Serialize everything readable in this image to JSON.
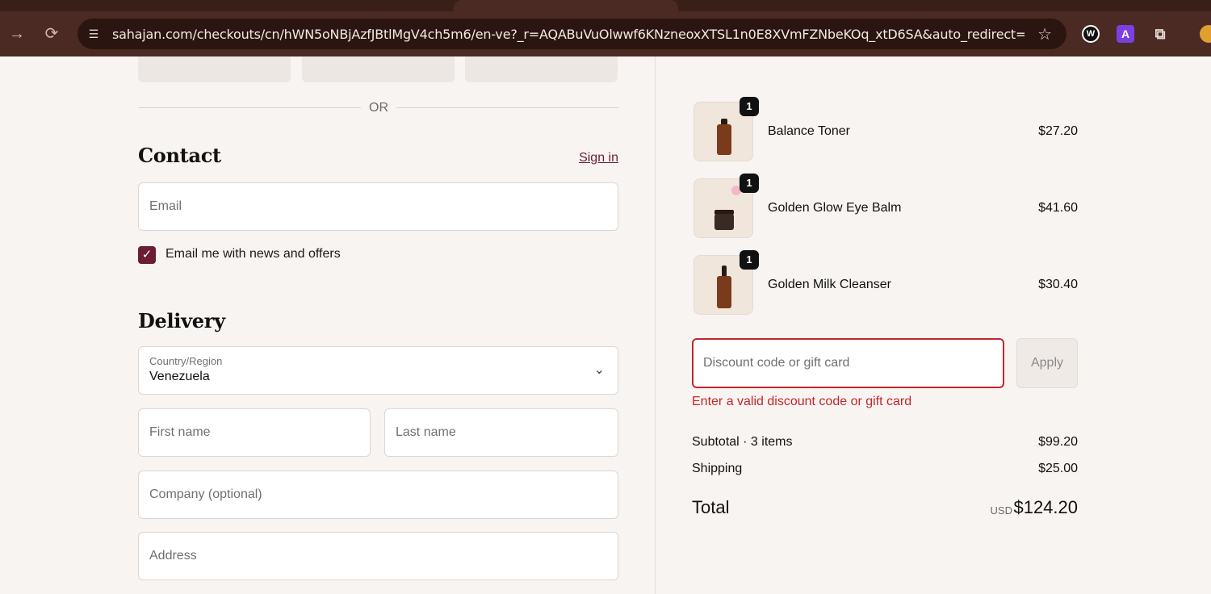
{
  "browser": {
    "url": "sahajan.com/checkouts/cn/hWN5oNBjAzfJBtlMgV4ch5m6/en-ve?_r=AQABuVuOlwwf6KNzneoxXTSL1n0E8XVmFZNbeKOq_xtD6SA&auto_redirect=false&...",
    "ext_a_label": "A"
  },
  "express": {
    "or_label": "OR"
  },
  "contact": {
    "heading": "Contact",
    "sign_in": "Sign in",
    "email_placeholder": "Email",
    "newsletter_label": "Email me with news and offers",
    "newsletter_checked": true
  },
  "delivery": {
    "heading": "Delivery",
    "country_label": "Country/Region",
    "country_value": "Venezuela",
    "first_name_placeholder": "First name",
    "last_name_placeholder": "Last name",
    "company_placeholder": "Company (optional)",
    "address_placeholder": "Address"
  },
  "order": {
    "items": [
      {
        "name": "Balance Toner",
        "qty": "1",
        "price": "$27.20"
      },
      {
        "name": "Golden Glow Eye Balm",
        "qty": "1",
        "price": "$41.60"
      },
      {
        "name": "Golden Milk Cleanser",
        "qty": "1",
        "price": "$30.40"
      }
    ],
    "discount_placeholder": "Discount code or gift card",
    "apply_label": "Apply",
    "discount_error": "Enter a valid discount code or gift card",
    "subtotal_label": "Subtotal · 3 items",
    "subtotal_value": "$99.20",
    "shipping_label": "Shipping",
    "shipping_value": "$25.00",
    "total_label": "Total",
    "total_currency": "USD",
    "total_value": "$124.20"
  },
  "colors": {
    "accent": "#6b1d33",
    "error": "#c0262d",
    "chrome": "#4a2a22"
  }
}
